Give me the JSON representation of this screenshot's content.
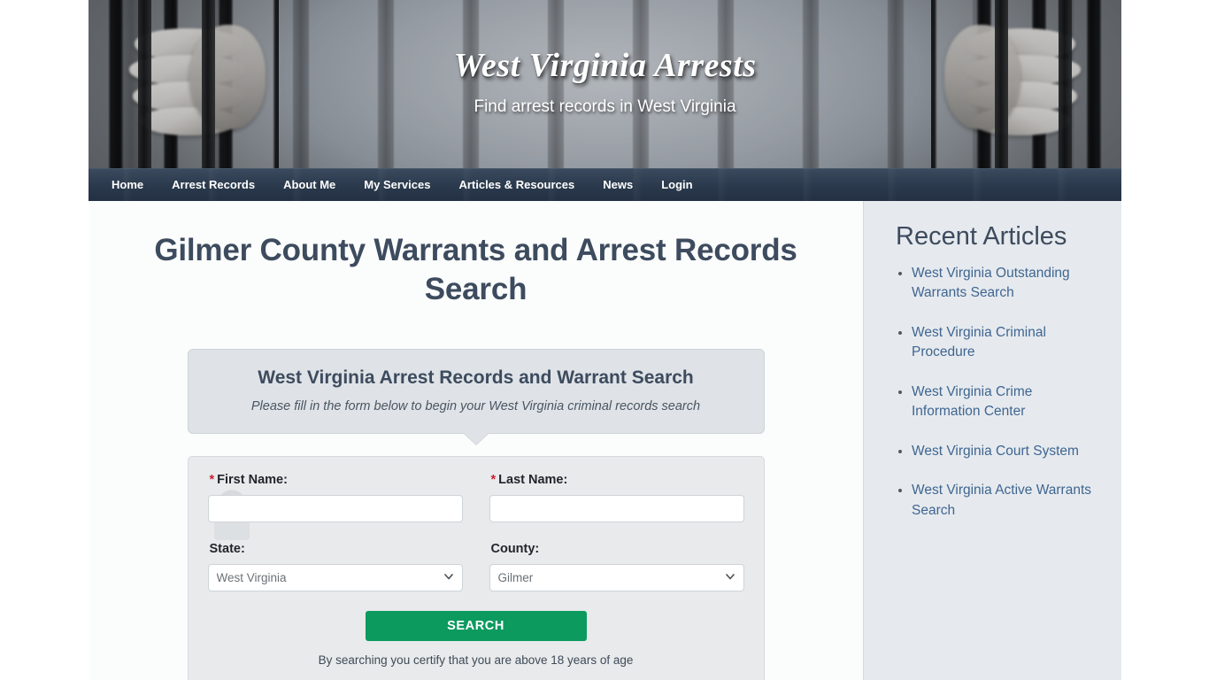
{
  "site": {
    "title": "West Virginia Arrests",
    "tagline": "Find arrest records in West Virginia"
  },
  "nav": {
    "items": [
      {
        "label": "Home"
      },
      {
        "label": "Arrest Records"
      },
      {
        "label": "About Me"
      },
      {
        "label": "My Services"
      },
      {
        "label": "Articles & Resources"
      },
      {
        "label": "News"
      },
      {
        "label": "Login"
      }
    ]
  },
  "main": {
    "page_title": "Gilmer County Warrants and Arrest Records Search",
    "callout": {
      "title": "West Virginia Arrest Records and Warrant Search",
      "subtitle": "Please fill in the form below to begin your West Virginia criminal records search"
    },
    "form": {
      "required_marker": "*",
      "first_name_label": "First Name:",
      "first_name_value": "",
      "first_name_placeholder": "",
      "last_name_label": "Last Name:",
      "last_name_value": "",
      "last_name_placeholder": "",
      "state_label": "State:",
      "state_value": "West Virginia",
      "state_options": [
        "West Virginia"
      ],
      "county_label": "County:",
      "county_value": "Gilmer",
      "county_options": [
        "Gilmer"
      ],
      "search_button": "SEARCH",
      "disclaimer": "By searching you certify that you are above 18 years of age"
    }
  },
  "sidebar": {
    "title": "Recent Articles",
    "articles": [
      {
        "label": "West Virginia Outstanding Warrants Search"
      },
      {
        "label": "West Virginia Criminal Procedure"
      },
      {
        "label": "West Virginia Crime Information Center"
      },
      {
        "label": "West Virginia Court System"
      },
      {
        "label": "West Virginia Active Warrants Search"
      }
    ]
  },
  "colors": {
    "nav_background": "#2b3a4d",
    "heading": "#3d4b5e",
    "link": "#3f6591",
    "search_button": "#0c9a5f",
    "required_star": "#cc2233",
    "sidebar_background": "#e6eaee"
  }
}
